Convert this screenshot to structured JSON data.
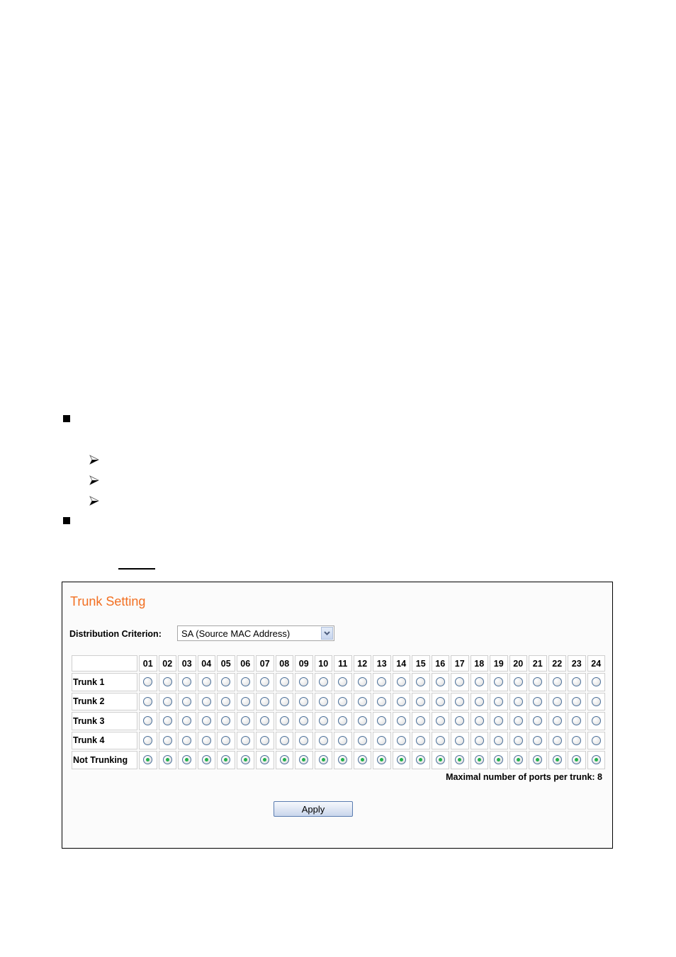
{
  "document": {
    "bullets": [
      {
        "type": "square",
        "icon": "square-bullet-icon"
      },
      {
        "type": "arrow",
        "icon": "arrow-bullet-icon"
      },
      {
        "type": "arrow",
        "icon": "arrow-bullet-icon"
      },
      {
        "type": "arrow",
        "icon": "arrow-bullet-icon"
      },
      {
        "type": "square",
        "icon": "square-bullet-icon"
      }
    ]
  },
  "panel": {
    "title": "Trunk Setting",
    "distribution": {
      "label": "Distribution Criterion:",
      "selected": "SA (Source MAC Address)"
    },
    "ports": [
      "01",
      "02",
      "03",
      "04",
      "05",
      "06",
      "07",
      "08",
      "09",
      "10",
      "11",
      "12",
      "13",
      "14",
      "15",
      "16",
      "17",
      "18",
      "19",
      "20",
      "21",
      "22",
      "23",
      "24"
    ],
    "rows": [
      {
        "label": "Trunk 1",
        "checked": false
      },
      {
        "label": "Trunk 2",
        "checked": false
      },
      {
        "label": "Trunk 3",
        "checked": false
      },
      {
        "label": "Trunk 4",
        "checked": false
      },
      {
        "label": "Not Trunking",
        "checked": true
      }
    ],
    "max_note": "Maximal number of ports per trunk: 8",
    "apply_label": "Apply",
    "colors": {
      "title": "#f26f21",
      "radio_checked": "#22b14c"
    }
  }
}
